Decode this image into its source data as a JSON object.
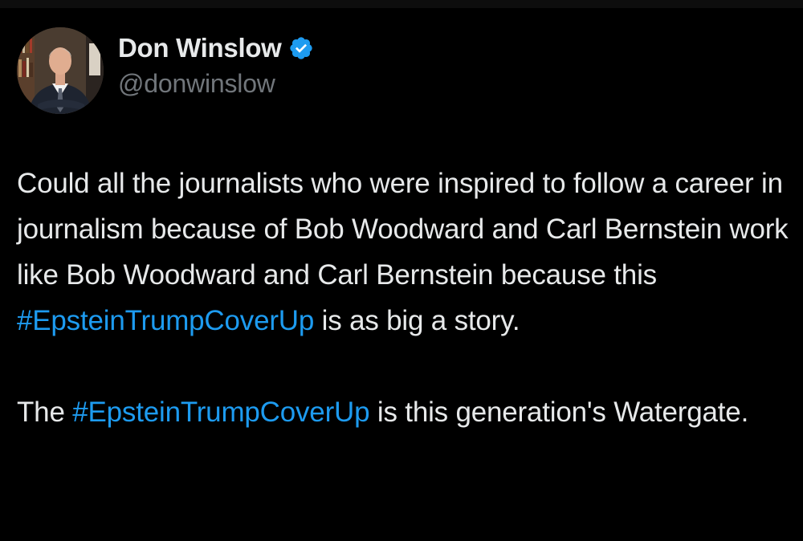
{
  "colors": {
    "background": "#000000",
    "text": "#e7e9ea",
    "secondary": "#71767b",
    "link": "#1d9bf0",
    "verified": "#1d9bf0"
  },
  "author": {
    "display_name": "Don Winslow",
    "handle": "@donwinslow",
    "verified_icon": "verified-badge-icon",
    "avatar_icon": "profile-photo"
  },
  "tweet": {
    "paragraph_1": {
      "text_before": "Could all the journalists who were inspired to follow a career in journalism because of Bob Woodward and Carl Bernstein work like Bob Woodward and Carl Bernstein because this ",
      "hashtag": "#EpsteinTrumpCoverUp",
      "text_after": " is as big a story."
    },
    "paragraph_2": {
      "text_before": "The ",
      "hashtag": "#EpsteinTrumpCoverUp",
      "text_after": " is this generation's Watergate."
    }
  }
}
